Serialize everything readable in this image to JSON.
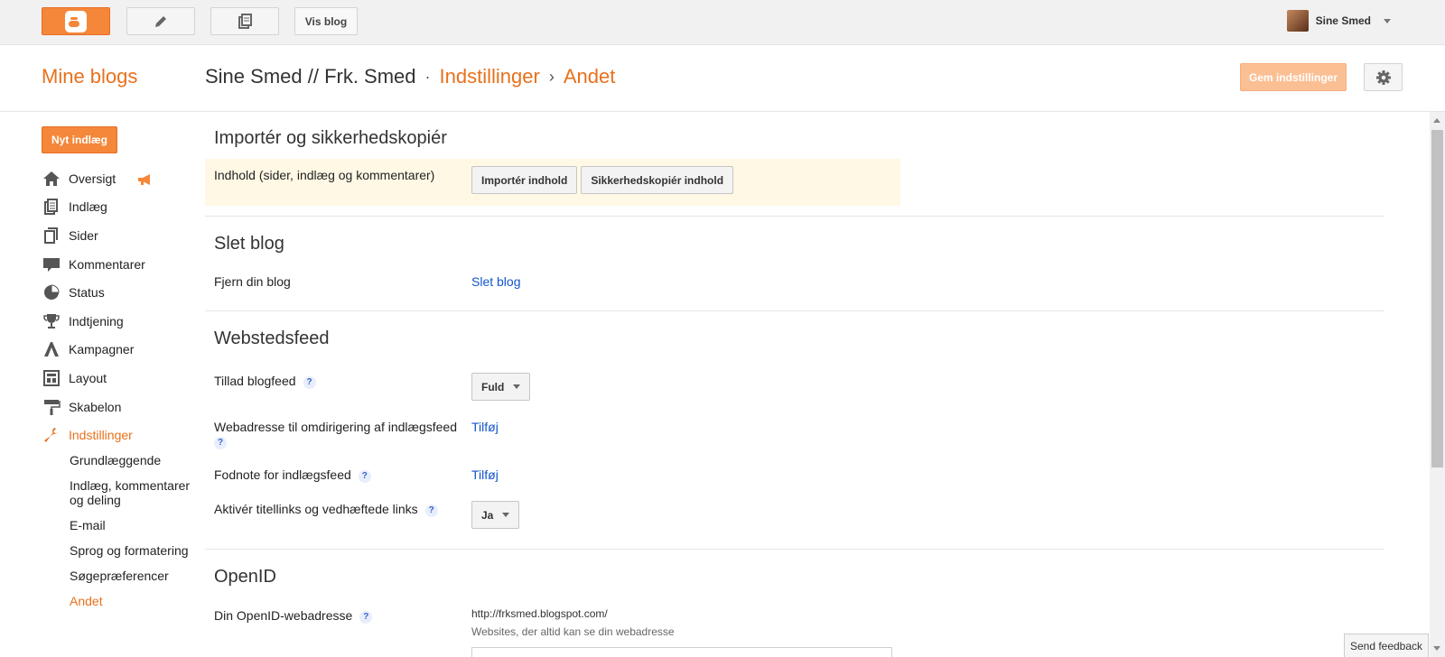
{
  "topbar": {
    "blogger_icon": "blogger-logo-icon",
    "pencil_icon": "pencil-icon",
    "pages_icon": "posts-list-icon",
    "view_blog_label": "Vis blog",
    "user_name": "Sine Smed"
  },
  "header": {
    "my_blogs": "Mine blogs",
    "blog_name": "Sine Smed // Frk. Smed",
    "sep_dot": "·",
    "section": "Indstillinger",
    "sep_arrow": "›",
    "subsection": "Andet",
    "save_label": "Gem indstillinger",
    "gear_icon": "gear-icon"
  },
  "sidebar": {
    "new_post": "Nyt indlæg",
    "items": [
      {
        "label": "Oversigt",
        "icon": "home-icon"
      },
      {
        "label": "Indlæg",
        "icon": "posts-icon"
      },
      {
        "label": "Sider",
        "icon": "pages-icon"
      },
      {
        "label": "Kommentarer",
        "icon": "comment-icon"
      },
      {
        "label": "Status",
        "icon": "pie-chart-icon"
      },
      {
        "label": "Indtjening",
        "icon": "trophy-icon"
      },
      {
        "label": "Kampagner",
        "icon": "adwords-icon"
      },
      {
        "label": "Layout",
        "icon": "layout-icon"
      },
      {
        "label": "Skabelon",
        "icon": "paint-roller-icon"
      },
      {
        "label": "Indstillinger",
        "icon": "wrench-icon"
      }
    ],
    "sub_items": [
      "Grundlæggende",
      "Indlæg, kommentarer og deling",
      "E-mail",
      "Sprog og formatering",
      "Søgepræferencer",
      "Andet"
    ],
    "active_color": "#e8711c"
  },
  "main": {
    "import_section": {
      "title": "Importér og sikkerhedskopiér",
      "content_label": "Indhold (sider, indlæg og kommentarer)",
      "import_button": "Importér indhold",
      "backup_button": "Sikkerhedskopiér indhold"
    },
    "delete_section": {
      "title": "Slet blog",
      "remove_label": "Fjern din blog",
      "delete_link": "Slet blog"
    },
    "feed_section": {
      "title": "Webstedsfeed",
      "allow_feed_label": "Tillad blogfeed",
      "allow_feed_value": "Fuld",
      "redirect_label": "Webadresse til omdirigering af indlægsfeed",
      "redirect_link": "Tilføj",
      "footer_label": "Fodnote for indlægsfeed",
      "footer_link": "Tilføj",
      "title_links_label": "Aktivér titellinks og vedhæftede links",
      "title_links_value": "Ja",
      "help": "?"
    },
    "openid_section": {
      "title": "OpenID",
      "address_label": "Din OpenID-webadresse",
      "address_value": "http://frksmed.blogspot.com/",
      "trusted_label": "Websites, der altid kan se din webadresse"
    }
  },
  "feedback_label": "Send feedback",
  "accent_color": "#f5873a"
}
